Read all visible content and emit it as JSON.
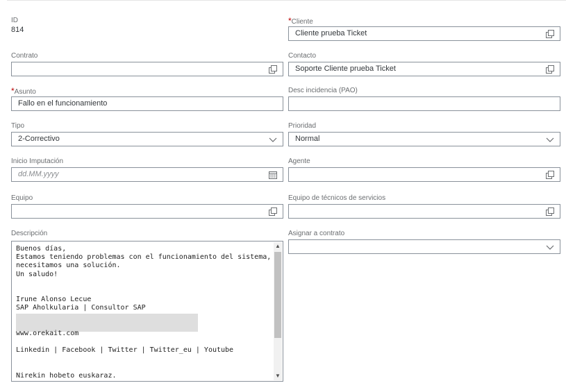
{
  "id": {
    "label": "ID",
    "value": "814"
  },
  "cliente": {
    "label": "Cliente",
    "value": "Cliente prueba Ticket",
    "icon": "value-help-icon"
  },
  "contrato": {
    "label": "Contrato",
    "value": "",
    "icon": "value-help-icon"
  },
  "contacto": {
    "label": "Contacto",
    "value": "Soporte Cliente prueba Ticket",
    "icon": "value-help-icon"
  },
  "asunto": {
    "label": "Asunto",
    "value": "Fallo en el funcionamiento"
  },
  "desc_incidencia": {
    "label": "Desc incidencia (PAO)",
    "value": ""
  },
  "tipo": {
    "label": "Tipo",
    "value": "2-Correctivo",
    "icon": "chevron-down-icon"
  },
  "prioridad": {
    "label": "Prioridad",
    "value": "Normal",
    "icon": "chevron-down-icon"
  },
  "inicio_imputacion": {
    "label": "Inicio Imputación",
    "placeholder": "dd.MM.yyyy",
    "icon": "calendar-icon"
  },
  "agente": {
    "label": "Agente",
    "value": "",
    "icon": "value-help-icon"
  },
  "equipo": {
    "label": "Equipo",
    "value": "",
    "icon": "value-help-icon"
  },
  "equipo_tecnicos": {
    "label": "Equipo de técnicos de servicios",
    "value": "",
    "icon": "value-help-icon"
  },
  "descripcion": {
    "label": "Descripción",
    "lines": [
      "Buenos días,",
      "Estamos teniendo problemas con el funcionamiento del sistema,",
      "necesitamos una solución.",
      "Un saludo!",
      "",
      "",
      "Irune Alonso Lecue",
      "SAP Aholkularia | Consultor SAP",
      "",
      "",
      "www.orekait.com",
      "",
      "Linkedin  |  Facebook  |  Twitter  |  Twitter_eu  |  Youtube",
      "",
      "",
      "Nirekin hobeto euskaraz."
    ]
  },
  "asignar_contrato": {
    "label": "Asignar a contrato",
    "value": "",
    "icon": "chevron-down-icon"
  },
  "colors": {
    "required": "#bb0000",
    "border": "#89919a",
    "label": "#6a6d70",
    "text": "#32363a"
  }
}
